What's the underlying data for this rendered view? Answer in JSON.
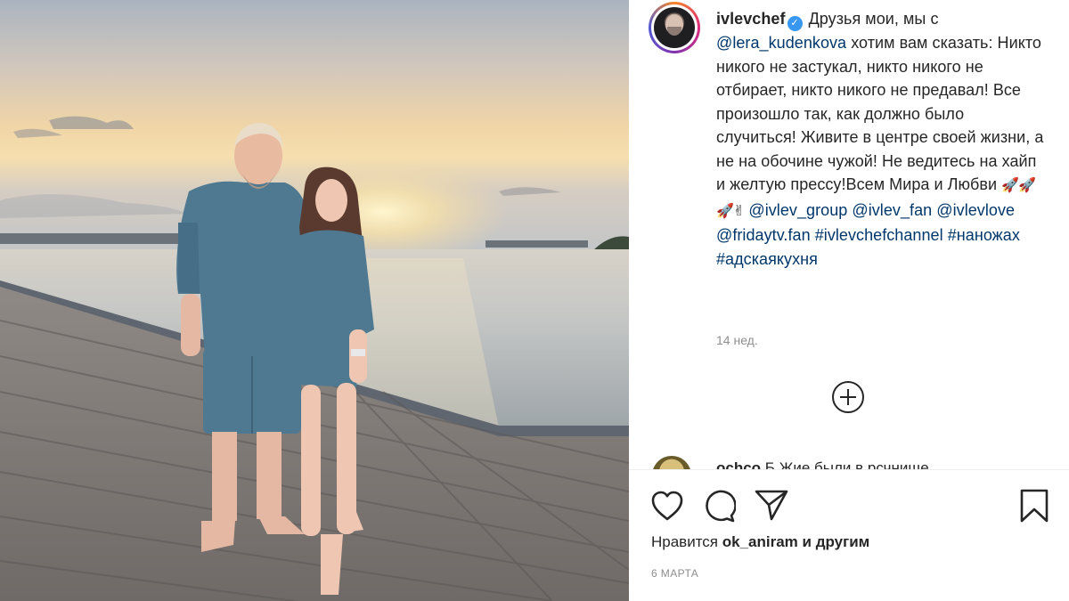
{
  "post": {
    "author": {
      "username": "ivlevchef",
      "verified": true
    },
    "caption": {
      "intro": "Друзья мои, мы с",
      "mention_partner": "@lera_kudenkova",
      "body": "хотим вам сказать: Никто никого не застукал, никто никого не отбирает, никто никого не предавал! Все произошло так, как должно было случиться! Живите в центре своей жизни, а не на обочине чужой! Не ведитесь на хайп и желтую прессу!Всем Мира и Любви",
      "emojis": "🚀🚀🚀✌",
      "mentions": [
        "@ivlev_group",
        "@ivlev_fan",
        "@ivlevlove",
        "@fridaytv.fan"
      ],
      "hashtags": [
        "#ivlevchefchannel",
        "#наножах",
        "#адскаякухня"
      ]
    },
    "age": "14 нед.",
    "partial_comment": {
      "username": "ochco",
      "text": "Б Жие были в рсчнище"
    },
    "likes": {
      "prefix": "Нравится",
      "user": "ok_aniram",
      "suffix": "и другим"
    },
    "date": "6 МАРТА"
  },
  "icons": {
    "like": "heart-icon",
    "comment": "comment-icon",
    "share": "share-icon",
    "save": "bookmark-icon",
    "load_more": "plus-circle-icon"
  },
  "colors": {
    "text": "#262626",
    "link": "#00376b",
    "muted": "#8e8e8e",
    "verified": "#3897f0"
  }
}
